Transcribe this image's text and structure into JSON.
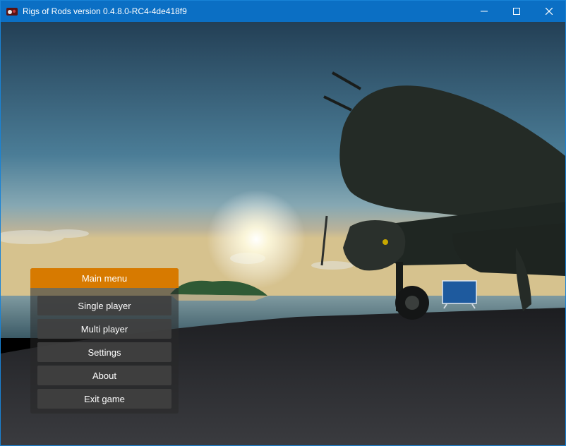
{
  "window": {
    "title": "Rigs of Rods version 0.4.8.0-RC4-4de418f9",
    "controls": {
      "minimize_icon": "minimize-icon",
      "maximize_icon": "maximize-icon",
      "close_icon": "close-icon"
    }
  },
  "colors": {
    "titlebar": "#0b6fc4",
    "menu_header": "#d77a00",
    "menu_button": "#404040"
  },
  "main_menu": {
    "title": "Main menu",
    "items": [
      {
        "label": "Single player"
      },
      {
        "label": "Multi player"
      },
      {
        "label": "Settings"
      },
      {
        "label": "About"
      },
      {
        "label": "Exit game"
      }
    ]
  }
}
